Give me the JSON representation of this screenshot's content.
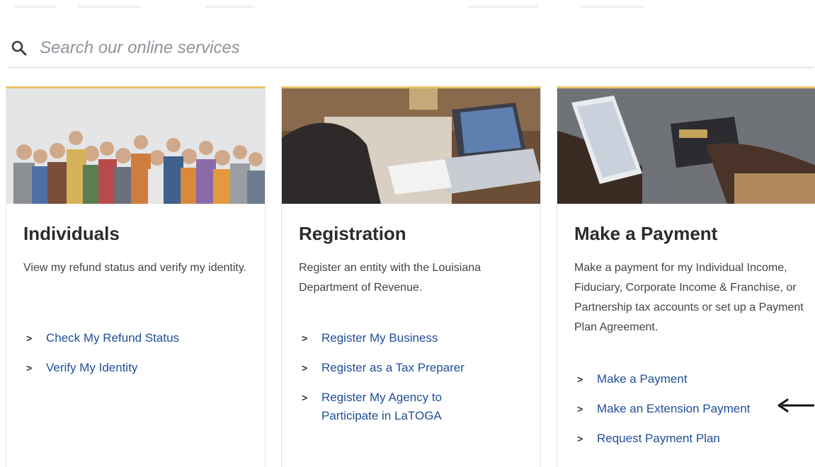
{
  "search": {
    "placeholder": "Search our online services"
  },
  "cards": [
    {
      "title": "Individuals",
      "description": "View my refund status and verify my identity.",
      "links": [
        "Check My Refund Status",
        "Verify My Identity"
      ]
    },
    {
      "title": "Registration",
      "description": "Register an entity with the Louisiana Department of Revenue.",
      "links": [
        "Register My Business",
        "Register as a Tax Preparer",
        "Register My Agency to Participate in LaTOGA"
      ]
    },
    {
      "title": "Make a Payment",
      "description": "Make a payment for my Individual Income, Fiduciary, Corporate Income & Franchise, or Partnership tax accounts or set up a Payment Plan Agreement.",
      "links": [
        "Make a Payment",
        "Make an Extension Payment",
        "Request Payment Plan"
      ]
    }
  ],
  "colors": {
    "accent": "#e8c468",
    "link": "#1f4e9a"
  },
  "icons": {
    "search": "search-icon",
    "chevron": "chevron-right-icon",
    "annotation": "arrow-left-icon"
  }
}
